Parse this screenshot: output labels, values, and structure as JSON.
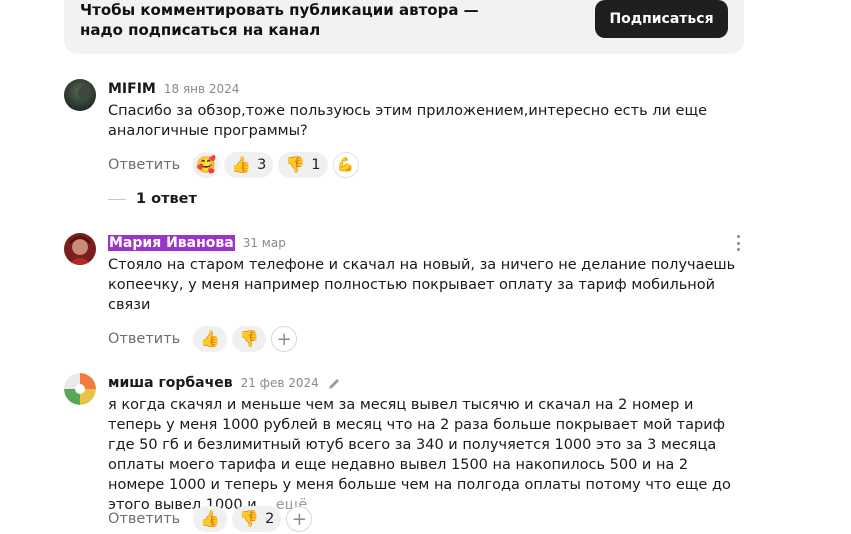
{
  "banner": {
    "text": "Чтобы комментировать публикации автора — надо подписаться на канал",
    "subscribe_label": "Подписаться"
  },
  "comments": [
    {
      "author": "MIFIM",
      "date": "18 янв 2024",
      "text": "Спасибо за обзор,тоже пользуюсь этим приложением,интересно есть ли еще аналогичные программы?",
      "reply_label": "Ответить",
      "likes": "3",
      "dislikes": "1",
      "replies_label": "1 ответ"
    },
    {
      "author": "Мария Иванова",
      "date": "31 мар",
      "text": "Стояло на старом телефоне и скачал на новый, за ничего не делание получаешь копеечку, у меня например полностью покрывает оплату за тариф мобильной связи",
      "reply_label": "Ответить"
    },
    {
      "author": "миша горбачев",
      "date": "21 фев 2024",
      "text": "я когда скачял и меньше чем за месяц вывел тысячю и скачал на 2 номер и теперь у меня 1000 рублей в месяц что на 2 раза больше покрывает мой тариф где 50 гб и безлимитный ютуб всего за 340 и получяется 1000 это за 3 месяца оплаты моего тарифа и еще недавно вывел 1500 на накопилось 500 и на 2 номере 1000 и теперь у меня больше чем на полгода оплаты потому что еще до этого вывел 1000 и…",
      "more_label": "ещё",
      "reply_label": "Ответить",
      "dislikes": "2"
    }
  ],
  "icons": {
    "like": "👍",
    "dislike": "👎",
    "heart_face": "🥰",
    "muscle": "💪",
    "plus": "+"
  }
}
